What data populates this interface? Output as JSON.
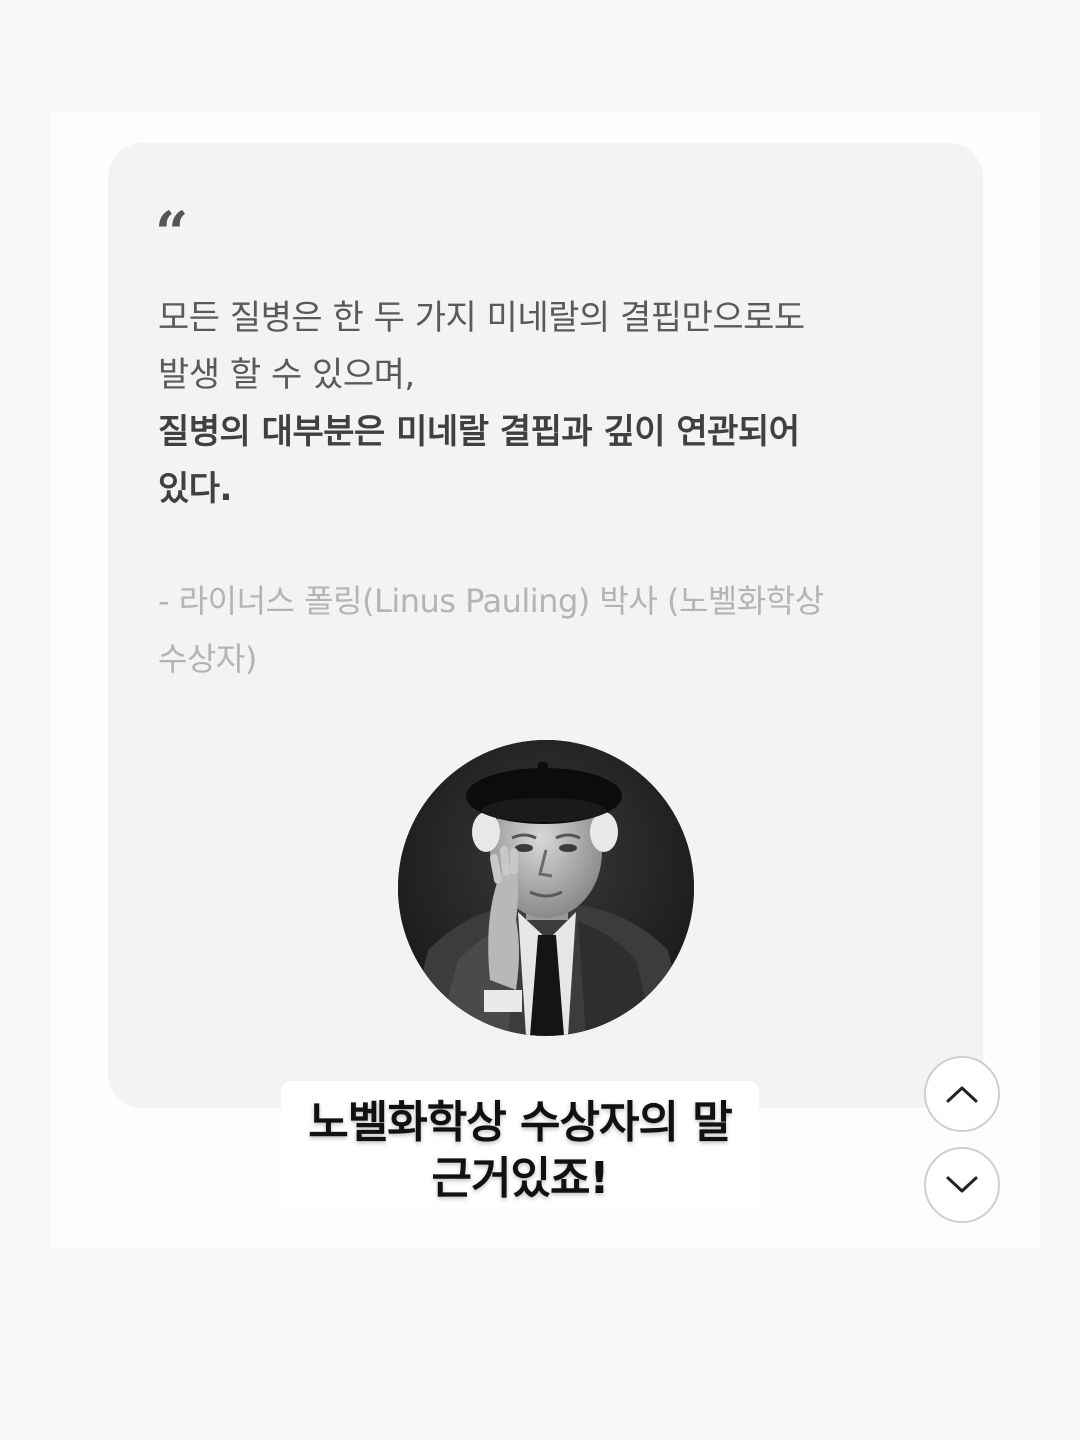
{
  "quote": {
    "mark": "“",
    "lines": [
      {
        "text": "모든 질병은 한 두 가지 미네랄의 결핍만으로도",
        "bold": false
      },
      {
        "text": "발생 할 수 있으며,",
        "bold": false
      },
      {
        "text": "질병의 대부분은 미네랄 결핍과 깊이 연관되어",
        "bold": true
      },
      {
        "text": "있다.",
        "bold": true
      }
    ]
  },
  "attribution": {
    "lines": [
      "- 라이너스 폴링(Linus Pauling) 박사 (노벨화학상",
      "수상자)"
    ]
  },
  "portrait": {
    "subject": "Linus Pauling portrait",
    "style": "black-and-white"
  },
  "caption": {
    "lines": [
      "노벨화학상 수상자의 말",
      "근거있죠!"
    ]
  },
  "nav": {
    "up_icon": "chevron-up-icon",
    "down_icon": "chevron-down-icon"
  },
  "colors": {
    "page_bg": "#f8f8f8",
    "card_bg": "#f3f3f3",
    "body_text": "#5a5a5a",
    "attribution_text": "#b4b4b4"
  }
}
